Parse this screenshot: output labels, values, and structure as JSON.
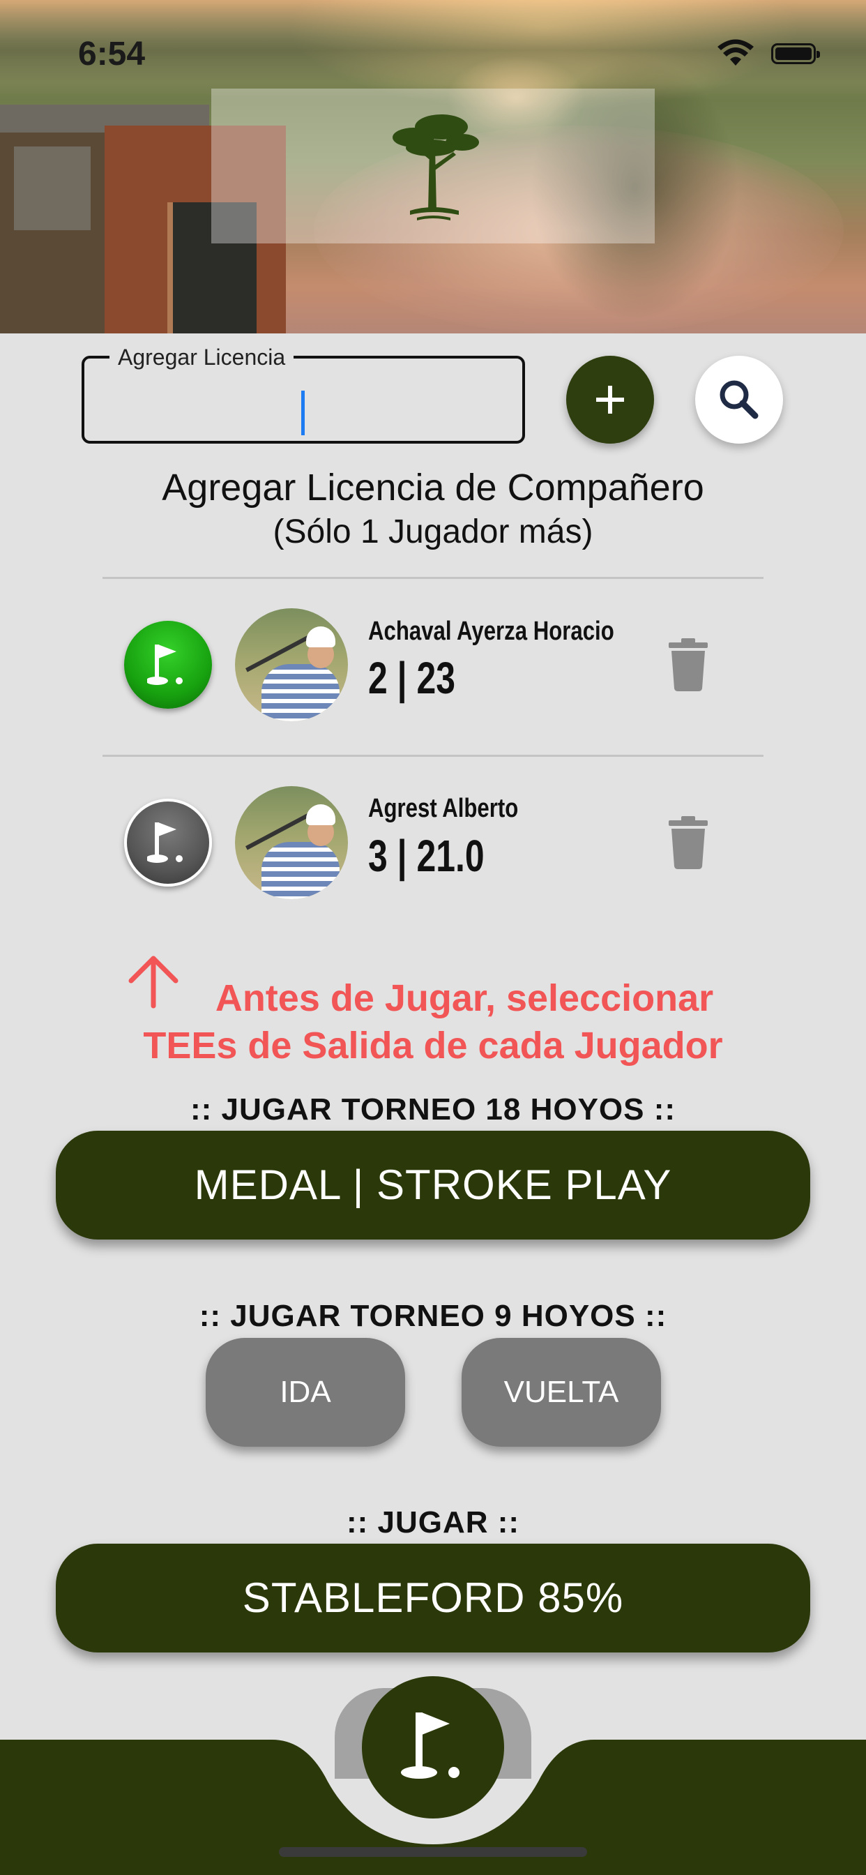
{
  "status_bar": {
    "time": "6:54"
  },
  "license_input": {
    "label": "Agregar Licencia",
    "value": ""
  },
  "buttons": {
    "add_icon": "plus-icon",
    "search_icon": "magnifier-icon"
  },
  "instructions": {
    "title": "Agregar Licencia de Compañero",
    "subtitle": "(Sólo 1 Jugador más)"
  },
  "players": [
    {
      "name": "Achaval Ayerza Horacio",
      "handicap": "2 | 23",
      "tee_color": "#1fa514"
    },
    {
      "name": "Agrest Alberto",
      "handicap": "3 | 21.0",
      "tee_color": "#5a5a5a"
    }
  ],
  "warning": {
    "line1": "Antes de Jugar, seleccionar",
    "line2": "TEEs de Salida de cada Jugador",
    "color": "#f25555"
  },
  "sections": {
    "torneo18": ":: JUGAR TORNEO 18 HOYOS ::",
    "torneo9": ":: JUGAR TORNEO 9 HOYOS ::",
    "jugar": ":: JUGAR ::"
  },
  "actions": {
    "medal": "MEDAL | STROKE PLAY",
    "ida": "IDA",
    "vuelta": "VUELTA",
    "stableford": "STABLEFORD 85%"
  },
  "colors": {
    "primary": "#2b390a",
    "background": "#e2e2e2",
    "pill": "#7a7a7a"
  }
}
